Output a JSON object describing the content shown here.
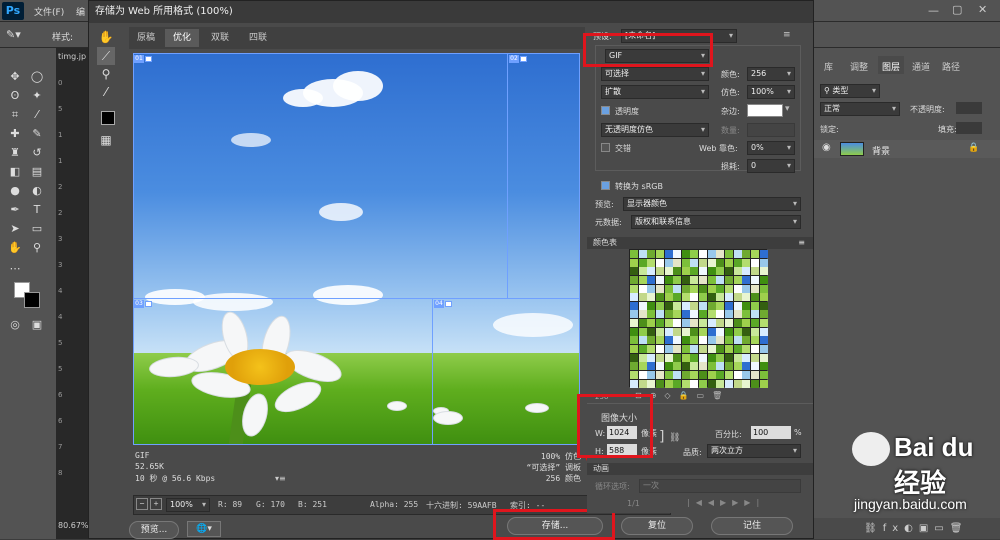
{
  "app": {
    "logo": "Ps",
    "menu": [
      "文件(F)",
      "编"
    ]
  },
  "options_bar": {
    "style_label": "样式:"
  },
  "document": {
    "tab": "timg.jp",
    "zoom": "80.67%",
    "ruler_marks": [
      "0",
      "5",
      "1",
      "1",
      "2",
      "2",
      "3",
      "3",
      "4",
      "4",
      "5",
      "5",
      "6",
      "6",
      "7",
      "8"
    ]
  },
  "dialog": {
    "title": "存储为 Web 所用格式 (100%)",
    "tabs": [
      "原稿",
      "优化",
      "双联",
      "四联"
    ],
    "active_tab": "优化",
    "slices": [
      "01",
      "02",
      "03",
      "04"
    ],
    "image_info_left": [
      "GIF",
      "52.65K",
      "10 秒 @ 56.6 Kbps"
    ],
    "image_info_right": [
      "100% 仿色",
      "“可选择” 调板",
      "256 颜色"
    ],
    "status": {
      "zoom": "100%",
      "r": "R: 89",
      "g": "G: 170",
      "b": "B: 251",
      "alpha": "Alpha: 255",
      "hex": "十六进制: 59AAFB",
      "index": "索引: --"
    },
    "preview_button": "预览...",
    "preset_label": "预设:",
    "preset_value": "[未命名]",
    "format": "GIF",
    "reduction": "可选择",
    "dither_algo": "扩散",
    "colors_label": "颜色:",
    "colors_value": "256",
    "dither_label": "仿色:",
    "dither_value": "100%",
    "transparency_label": "透明度",
    "matte_label": "杂边:",
    "trans_dither": "无透明度仿色",
    "amount_label": "数量:",
    "interlaced_label": "交错",
    "web_snap_label": "Web 靠色:",
    "web_snap_value": "0%",
    "lossy_label": "损耗:",
    "lossy_value": "0",
    "convert_srgb": "转换为 sRGB",
    "preview_label": "预览:",
    "preview_value": "显示器颜色",
    "metadata_label": "元数据:",
    "metadata_value": "版权和联系信息",
    "color_table_title": "颜色表",
    "color_count": "256",
    "image_size_title": "图像大小",
    "width_label": "W:",
    "width_value": "1024",
    "height_label": "H:",
    "height_value": "588",
    "unit": "像素",
    "percent_label": "百分比:",
    "percent_value": "100",
    "quality_label": "品质:",
    "quality_value": "两次立方",
    "animation_title": "动画",
    "loop_label": "循环选项:",
    "loop_value": "一次",
    "frame": "1/1",
    "save_button": "存储...",
    "reset_button": "复位",
    "remember_button": "记住"
  },
  "layers_panel": {
    "tabs": [
      "库",
      "调整",
      "图层",
      "通道",
      "路径"
    ],
    "kind": "类型",
    "blend": "正常",
    "opacity_label": "不透明度:",
    "lock_label": "锁定:",
    "fill_label": "填充:",
    "layer_name": "背景"
  },
  "watermark": {
    "brand": "Bai du 经验",
    "url": "jingyan.baidu.com"
  }
}
